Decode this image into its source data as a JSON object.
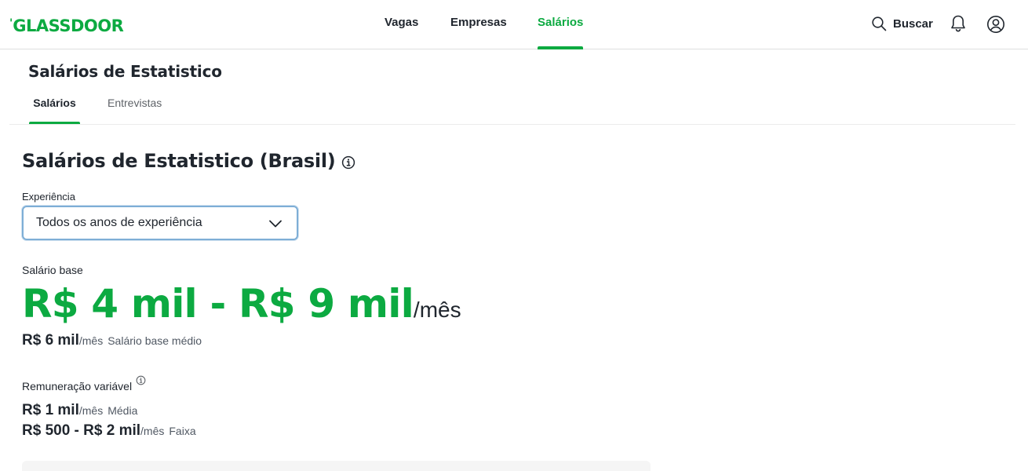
{
  "header": {
    "logo_text": "GLASSDOOR",
    "logo_mark": "'",
    "nav": [
      {
        "label": "Vagas",
        "active": false
      },
      {
        "label": "Empresas",
        "active": false
      },
      {
        "label": "Salários",
        "active": true
      }
    ],
    "search_label": "Buscar",
    "icons": [
      "search-icon",
      "bell-icon",
      "user-icon"
    ],
    "accent_color": "#0caa41"
  },
  "subheader": {
    "title": "Salários de Estatistico",
    "tabs": [
      {
        "label": "Salários",
        "active": true
      },
      {
        "label": "Entrevistas",
        "active": false
      }
    ]
  },
  "main": {
    "title": "Salários de Estatistico (Brasil)",
    "experience": {
      "label": "Experiência",
      "selected": "Todos os anos de experiência"
    },
    "base_salary": {
      "label": "Salário base",
      "range": "R$ 4 mil - R$ 9 mil",
      "period": "/mês",
      "average_amount": "R$ 6 mil",
      "average_period": "/mês",
      "average_desc": "Salário base médio"
    },
    "variable_pay": {
      "label": "Remuneração variável",
      "average_amount": "R$ 1 mil",
      "average_period": "/mês",
      "average_desc": "Média",
      "range_amount": "R$ 500 - R$ 2 mil",
      "range_period": "/mês",
      "range_desc": "Faixa"
    }
  }
}
